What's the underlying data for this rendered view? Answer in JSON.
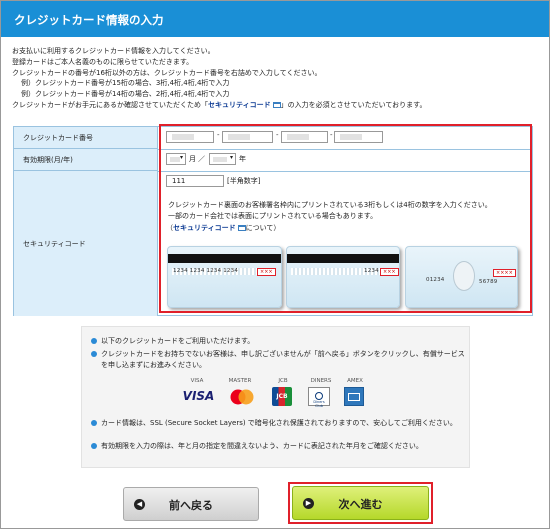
{
  "header": {
    "title": "クレジットカード情報の入力"
  },
  "intro": {
    "line1": "お支払いに利用するクレジットカード情報を入力してください。",
    "line2": "登録カードはご本人名義のものに限らせていただきます。",
    "line3": "クレジットカードの番号が16桁以外の方は、クレジットカード番号を右詰めで入力してください。",
    "line4": "例）クレジットカード番号が15桁の場合、3桁,4桁,4桁,4桁で入力",
    "line5": "例）クレジットカード番号が14桁の場合、2桁,4桁,4桁,4桁で入力",
    "line6_pre": "クレジットカードがお手元にあるか確認させていただくため「",
    "line6_link": "セキュリティコード",
    "line6_post": "」の入力を必須とさせていただいております。"
  },
  "form": {
    "card_number_label": "クレジットカード番号",
    "expiry_label": "有効期限(月/年)",
    "security_label": "セキュリティコード",
    "dash": "-",
    "month_unit": "月",
    "slash": "／",
    "year_unit": "年",
    "security_value": "111",
    "security_hint": "[半角数字]",
    "security_desc1": "クレジットカード裏面のお客様署名枠内にプリントされている3桁もしくは4桁の数字を入力ください。",
    "security_desc2": "一部のカード会社では表面にプリントされている場合もあります。",
    "security_link_open": "（",
    "security_link": "セキュリティコード",
    "security_link_close": "について）"
  },
  "cards": {
    "card1_number": "1234  1234  1234  1234",
    "card1_code": "×××",
    "card2_number": "1234",
    "card2_code": "×××",
    "card3_left": "01234",
    "card3_right": "56789",
    "card3_code": "××××"
  },
  "notice": {
    "item1": "以下のクレジットカードをご利用いただけます。",
    "item2": "クレジットカードをお持ちでないお客様は、申し訳ございませんが「前へ戻る」ボタンをクリックし、有償サービスを申し込まずにお進みください。",
    "item3": "カード情報は、SSL (Secure Socket Layers) で暗号化され保護されておりますので、安心してご利用ください。",
    "item4": "有効期限を入力の際は、年と月の指定を間違えないよう、カードに表記された年月をご確認ください。",
    "brands": [
      "VISA",
      "MASTER",
      "JCB",
      "DINERS",
      "AMEX"
    ],
    "visa_logo_text": "VISA",
    "jcb_logo_text": "JCB",
    "diners_logo_text": "Diners Club"
  },
  "buttons": {
    "back_label": "前へ戻る",
    "next_label": "次へ進む"
  },
  "colors": {
    "header": "#1a8fd6",
    "highlight": "#e0202a",
    "next_button": "#c5e03a",
    "label_bg": "#dceefa"
  }
}
